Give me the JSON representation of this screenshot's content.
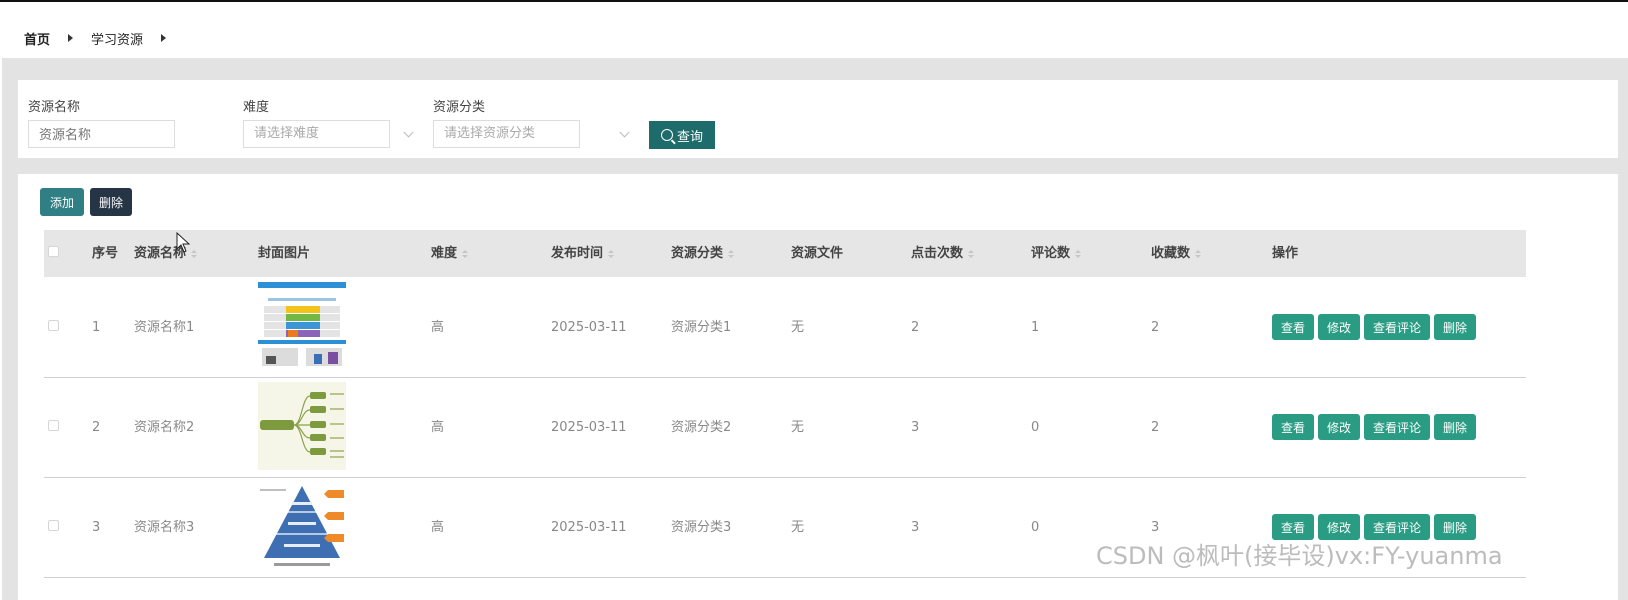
{
  "breadcrumb": {
    "home": "首页",
    "current": "学习资源"
  },
  "search": {
    "name_label": "资源名称",
    "name_placeholder": "资源名称",
    "difficulty_label": "难度",
    "difficulty_placeholder": "请选择难度",
    "category_label": "资源分类",
    "category_placeholder": "请选择资源分类",
    "query_label": "查询"
  },
  "toolbar": {
    "add_label": "添加",
    "delete_label": "删除"
  },
  "table": {
    "headers": {
      "index": "序号",
      "name": "资源名称",
      "cover": "封面图片",
      "difficulty": "难度",
      "publish_time": "发布时间",
      "category": "资源分类",
      "file": "资源文件",
      "clicks": "点击次数",
      "comments": "评论数",
      "favorites": "收藏数",
      "actions": "操作"
    },
    "rows": [
      {
        "index": "1",
        "name": "资源名称1",
        "difficulty": "高",
        "publish_time": "2025-03-11",
        "category": "资源分类1",
        "file": "无",
        "clicks": "2",
        "comments": "1",
        "favorites": "2"
      },
      {
        "index": "2",
        "name": "资源名称2",
        "difficulty": "高",
        "publish_time": "2025-03-11",
        "category": "资源分类2",
        "file": "无",
        "clicks": "3",
        "comments": "0",
        "favorites": "2"
      },
      {
        "index": "3",
        "name": "资源名称3",
        "difficulty": "高",
        "publish_time": "2025-03-11",
        "category": "资源分类3",
        "file": "无",
        "clicks": "3",
        "comments": "0",
        "favorites": "3"
      }
    ],
    "row_actions": {
      "view": "查看",
      "edit": "修改",
      "view_comments": "查看评论",
      "delete": "删除"
    }
  },
  "watermark": "CSDN @枫叶(接毕设)vx:FY-yuanma",
  "colors": {
    "query_button": "#1d6b6a",
    "add_button": "#2f7f85",
    "delete_button": "#253545",
    "row_action": "#2a9c83"
  }
}
